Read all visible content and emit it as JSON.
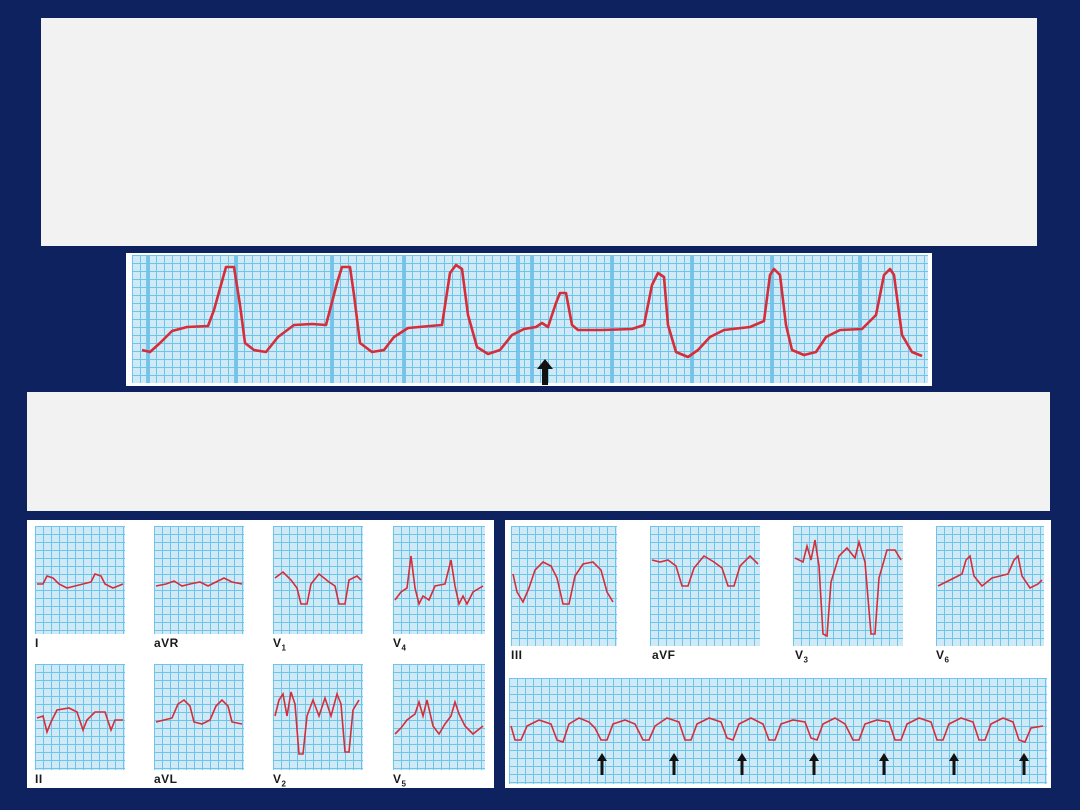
{
  "colors": {
    "background": "#0e2260",
    "panel": "#f2f2f2",
    "grid": "#6cc6ea",
    "grid_bg": "#cfe9f6",
    "trace": "#d62d3a"
  },
  "icons": {
    "arrow": "up-arrow-icon"
  },
  "leads_left": {
    "I": "I",
    "aVR": "aVR",
    "V1_main": "V",
    "V1_sub": "1",
    "V4_main": "V",
    "V4_sub": "4",
    "II": "II",
    "aVL": "aVL",
    "V2_main": "V",
    "V2_sub": "2",
    "V5_main": "V",
    "V5_sub": "5"
  },
  "leads_right": {
    "III": "III",
    "aVF": "aVF",
    "V3_main": "V",
    "V3_sub": "3",
    "V6_main": "V",
    "V6_sub": "6"
  }
}
